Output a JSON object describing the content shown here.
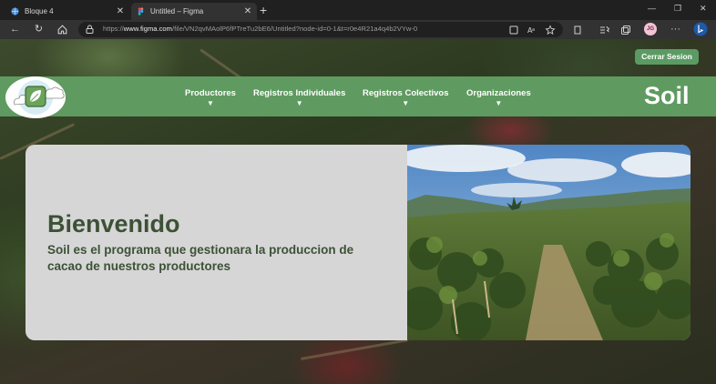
{
  "browser": {
    "tabs": [
      {
        "title": "Bloque 4",
        "close": "✕"
      },
      {
        "title": "Untitled – Figma",
        "close": "✕"
      }
    ],
    "new_tab": "+",
    "address": {
      "prefix": "https://",
      "host": "www.figma.com",
      "path": "/file/VN2qvMAolP6fPTreTu2bE6/Untitled?node-id=0-1&t=r0e4R21a4q4b2VYw-0"
    },
    "profile_initials": "JG"
  },
  "page": {
    "logout_label": "Cerrar Sesion",
    "nav": [
      {
        "label": "Productores",
        "caret": "▼"
      },
      {
        "label": "Registros Individuales",
        "caret": "▼"
      },
      {
        "label": "Registros Colectivos",
        "caret": "▼"
      },
      {
        "label": "Organizaciones",
        "caret": "▼"
      }
    ],
    "brand": "Soil",
    "hero": {
      "title": "Bienvenido",
      "subtitle": "Soil es el programa que gestionara la produccion de cacao de nuestros productores"
    }
  },
  "colors": {
    "nav_green": "#5f9a60",
    "button_green": "#5b9b63",
    "text_dark_green": "#3c5136",
    "card_gray": "#d6d6d6"
  }
}
